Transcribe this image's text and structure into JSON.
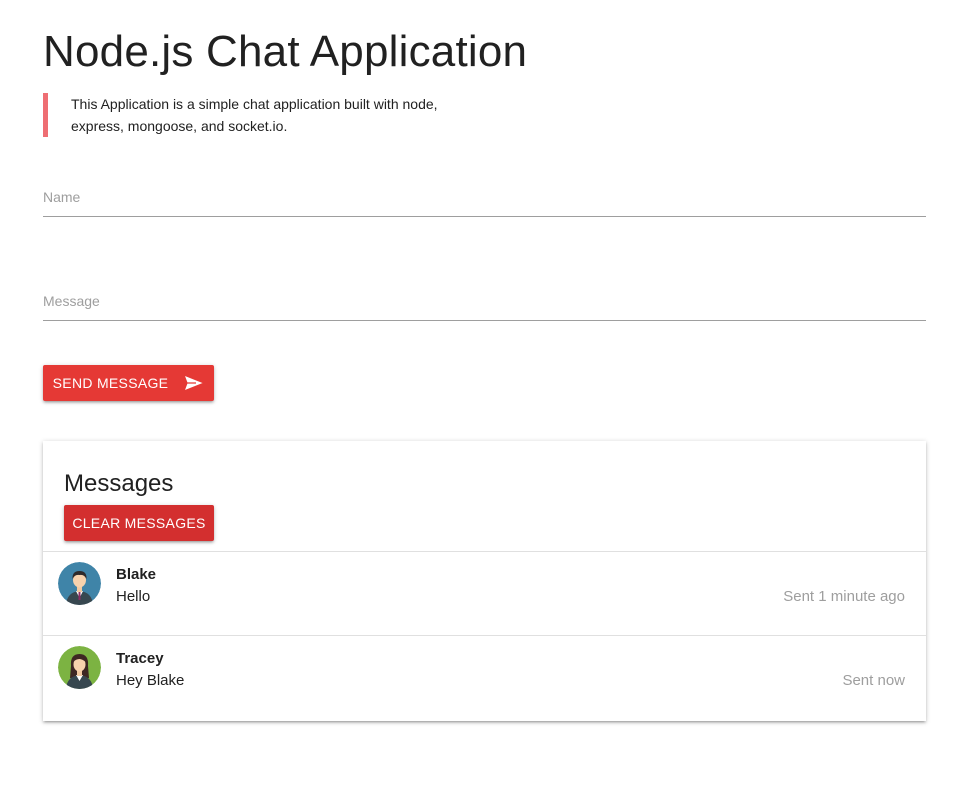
{
  "header": {
    "title": "Node.js Chat Application",
    "description": "This Application is a simple chat application built with node, express, mongoose, and socket.io."
  },
  "form": {
    "name_placeholder": "Name",
    "name_value": "",
    "message_placeholder": "Message",
    "message_value": "",
    "send_label": "SEND MESSAGE",
    "send_icon": "send-icon"
  },
  "messages_card": {
    "title": "Messages",
    "clear_label": "CLEAR MESSAGES",
    "items": [
      {
        "author": "Blake",
        "text": "Hello",
        "time": "Sent 1 minute ago",
        "avatar": "male-avatar-icon"
      },
      {
        "author": "Tracey",
        "text": "Hey Blake",
        "time": "Sent now",
        "avatar": "female-avatar-icon"
      }
    ]
  },
  "colors": {
    "accent": "#e53935",
    "clear_button": "#d32f2f",
    "blockquote_border": "#ee6e73",
    "muted_text": "#9e9e9e"
  }
}
